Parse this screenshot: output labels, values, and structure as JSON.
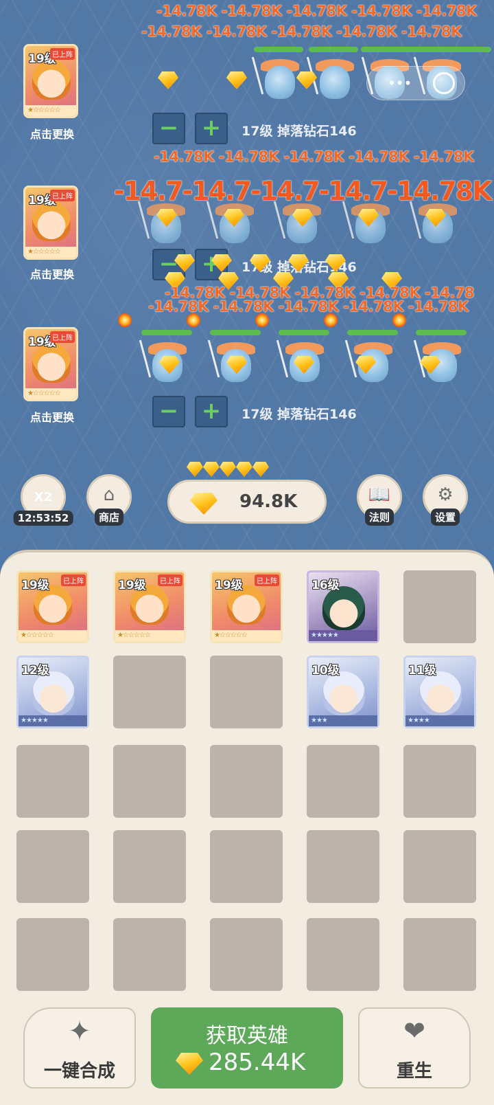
{
  "lanes": [
    {
      "hero_level": "19级",
      "hero_tag": "已上阵",
      "hero_stars": "★☆☆☆☆☆",
      "change_label": "点击更换",
      "minus": "−",
      "plus": "+",
      "drop_label": "17级 掉落钻石146"
    },
    {
      "hero_level": "19级",
      "hero_tag": "已上阵",
      "hero_stars": "★☆☆☆☆☆",
      "change_label": "点击更换",
      "minus": "−",
      "plus": "+",
      "drop_label": "17级 掉落钻石146"
    },
    {
      "hero_level": "19级",
      "hero_tag": "已上阵",
      "hero_stars": "★☆☆☆☆☆",
      "change_label": "点击更换",
      "minus": "−",
      "plus": "+",
      "drop_label": "17级 掉落钻石146"
    }
  ],
  "damage": {
    "row1": "-14.78K -14.78K -14.78K -14.78K -14.78K",
    "row2": "-14.78K -14.78K -14.78K -14.78K -14.78K",
    "row3": "-14.78K -14.78K -14.78K -14.78K -14.78K",
    "row4_big": "-14.7-14.7-14.7-14.7-14.78K",
    "row5": "-14.78K -14.78K -14.78K -14.78K -14.78",
    "row6": "-14.78K -14.78K -14.78K -14.78K -14.78K"
  },
  "toolbar": {
    "boost": {
      "label": "X2",
      "timer": "12:53:52"
    },
    "shop": "商店",
    "diamonds": "94.8K",
    "rules": "法则",
    "settings": "设置"
  },
  "inventory": {
    "rows": [
      [
        {
          "type": "hero",
          "level": "19级",
          "tag": "已上阵",
          "stars": "★☆☆☆☆☆"
        },
        {
          "type": "hero",
          "level": "19级",
          "tag": "已上阵",
          "stars": "★☆☆☆☆☆"
        },
        {
          "type": "hero",
          "level": "19级",
          "tag": "已上阵",
          "stars": "★☆☆☆☆☆"
        },
        {
          "type": "cat",
          "level": "16级",
          "stars": "★★★★★"
        },
        {
          "type": "empty"
        }
      ],
      [
        {
          "type": "mage",
          "level": "12级",
          "stars": "★★★★★"
        },
        {
          "type": "empty"
        },
        {
          "type": "empty"
        },
        {
          "type": "mage",
          "level": "10级",
          "stars": "★★★"
        },
        {
          "type": "mage",
          "level": "11级",
          "stars": "★★★★"
        }
      ]
    ]
  },
  "bottom": {
    "merge": "一键合成",
    "get_hero": "获取英雄",
    "get_hero_cost": "285.44K",
    "rebirth": "重生"
  },
  "colors": {
    "hp_bar": "#5cbc4e",
    "damage": "#f06a2a",
    "primary": "#5ea85a"
  }
}
